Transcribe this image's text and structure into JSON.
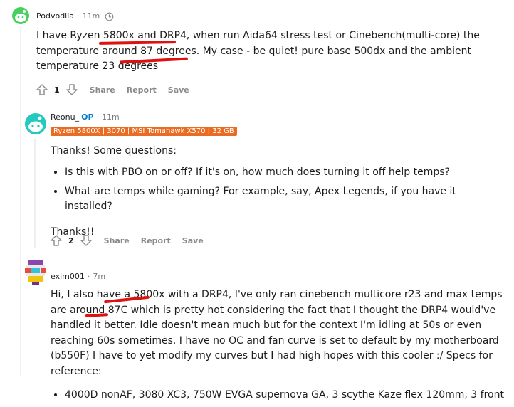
{
  "comments": [
    {
      "username": "Podvodila",
      "time": "11m",
      "body": "I have Ryzen 5800x and DRP4, when run Aida64 stress test or Cinebench(multi-core) the temperature around 87 degrees. My case - be quiet! pure base 500dx and the ambient temperature 23 degrees",
      "votes": "1",
      "share": "Share",
      "report": "Report",
      "save": "Save",
      "avatar_color": "#46d160"
    },
    {
      "username": "Reonu_",
      "op": "OP",
      "time": "11m",
      "flair": "Ryzen 5800X | 3070 | MSI Tomahawk X570 | 32 GB",
      "intro": "Thanks! Some questions:",
      "bullets": [
        "Is this with PBO on or off? If it's on, how much does turning it off help temps?",
        "What are temps while gaming? For example, say, Apex Legends, if you have it installed?"
      ],
      "outro": "Thanks!!",
      "votes": "2",
      "share": "Share",
      "report": "Report",
      "save": "Save",
      "avatar_color": "#24c9c0"
    },
    {
      "username": "exim001",
      "time": "7m",
      "body": "Hi, I also have a 5800x with a DRP4, I've only ran cinebench multicore r23 and max temps are around 87C which is pretty hot considering the fact that I thought the DRP4 would've handled it better. Idle doesn't mean much but for the context I'm idling at 50s or even reaching 60s sometimes. I have no OC and fan curve is set to default by my motherboard (b550F) I have to yet modify my curves but I had high hopes with this cooler :/ Specs for reference:",
      "bullet_partial": "4000D nonAF, 3080 XC3, 750W EVGA supernova GA, 3 scythe Kaze flex 120mm, 3 front"
    }
  ],
  "colors": {
    "annotation": "#e01111",
    "meta": "#787c7e",
    "flair_bg": "#ea6c23",
    "op": "#0079d3"
  }
}
